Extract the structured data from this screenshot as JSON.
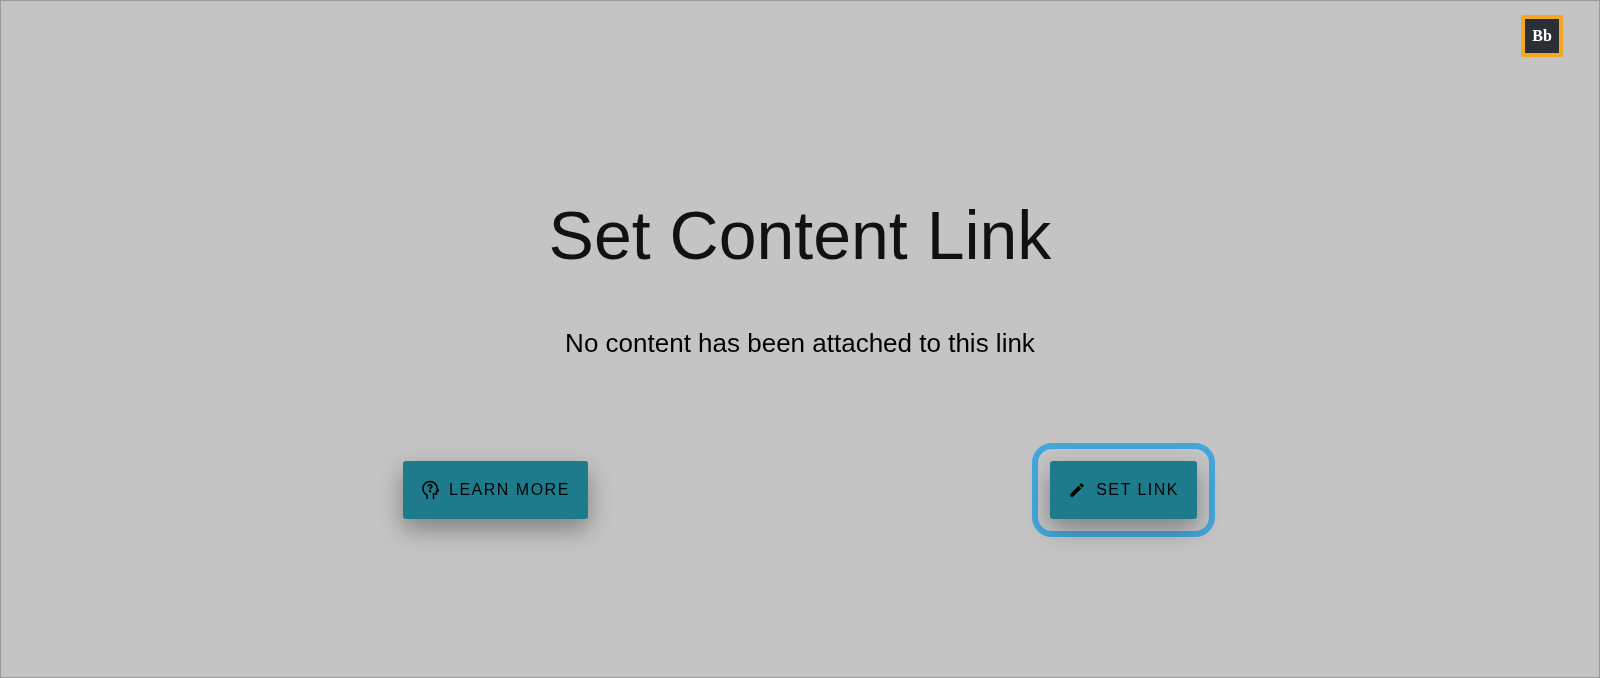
{
  "logo": {
    "text": "Bb"
  },
  "title": "Set Content Link",
  "message": "No content has been attached to this link",
  "buttons": [
    {
      "kind": "help",
      "label": "LEARN MORE",
      "focused": false
    },
    {
      "kind": "edit",
      "label": "SET LINK",
      "focused": true
    }
  ]
}
